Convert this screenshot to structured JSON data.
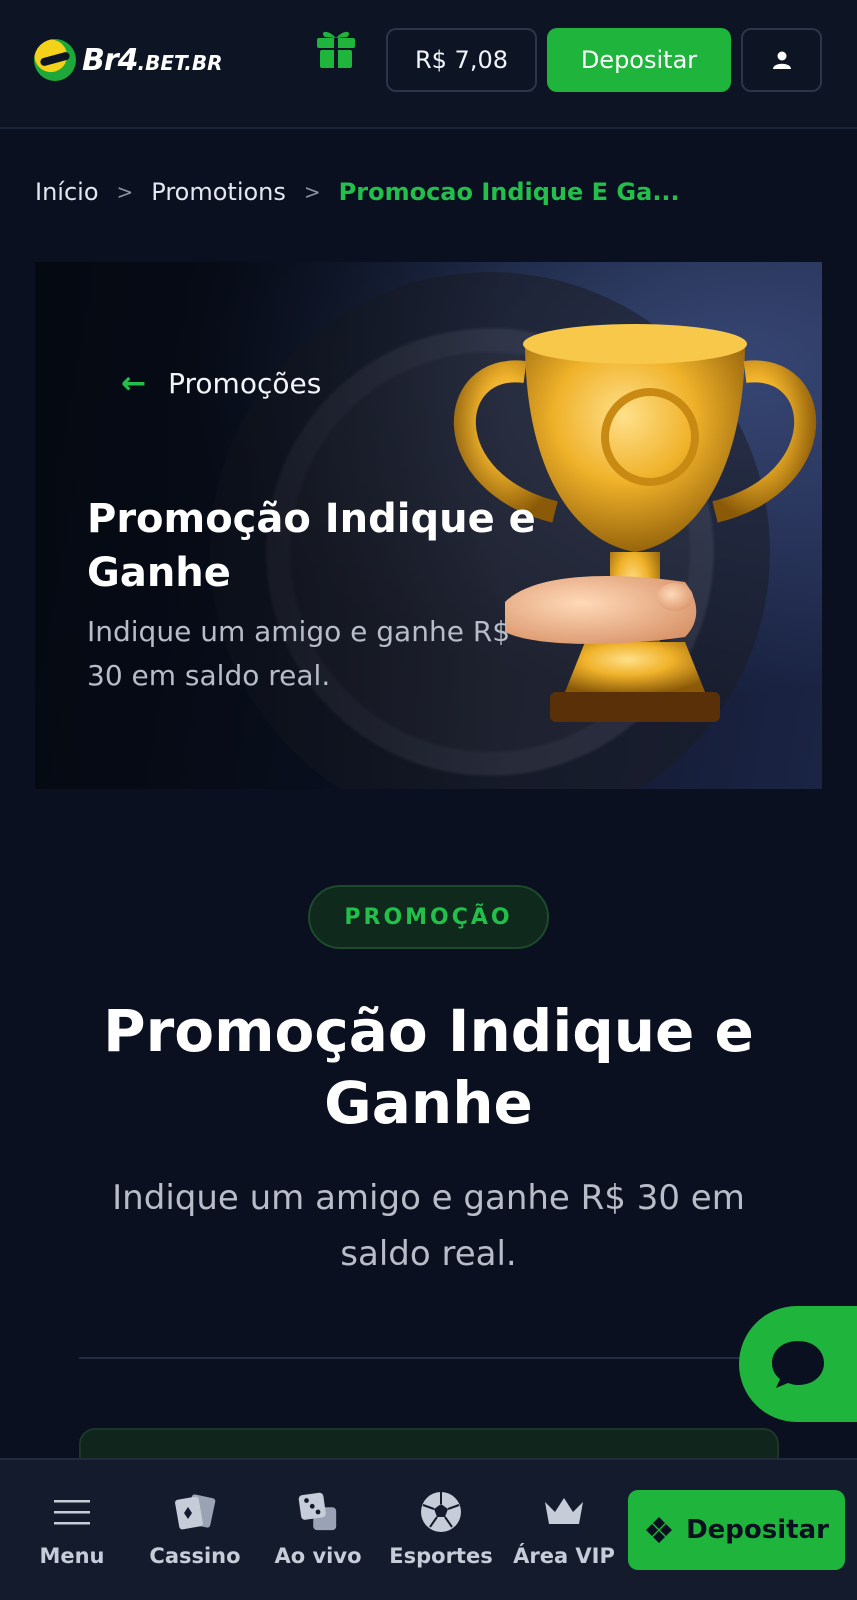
{
  "header": {
    "logo_text": "Br4",
    "logo_suffix": ".BET.BR",
    "balance": "R$ 7,08",
    "deposit_label": "Depositar"
  },
  "breadcrumb": {
    "items": [
      "Início",
      "Promotions"
    ],
    "separator": ">",
    "current": "Promocao Indique E Ga..."
  },
  "banner": {
    "back_label": "Promoções",
    "title": "Promoção Indique e Ganhe",
    "subtitle": "Indique um amigo e ganhe R$ 30 em saldo real."
  },
  "promo": {
    "tag": "PROMOÇÃO",
    "title": "Promoção Indique e Ganhe",
    "subtitle": "Indique um amigo e ganhe R$ 30 em saldo real."
  },
  "bottom_nav": {
    "items": [
      {
        "label": "Menu",
        "icon": "hamburger-icon"
      },
      {
        "label": "Cassino",
        "icon": "cards-icon"
      },
      {
        "label": "Ao vivo",
        "icon": "dice-icon"
      },
      {
        "label": "Esportes",
        "icon": "soccer-ball-icon"
      },
      {
        "label": "Área VIP",
        "icon": "crown-icon"
      }
    ],
    "deposit_label": "Depositar"
  },
  "colors": {
    "accent": "#1fb43c",
    "background": "#0b1020",
    "header_bg": "#0d1424"
  }
}
